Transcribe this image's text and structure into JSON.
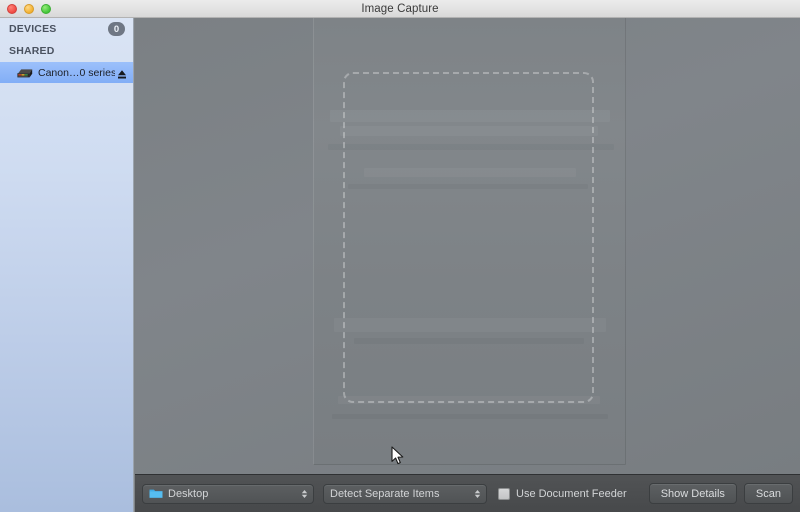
{
  "window": {
    "title": "Image Capture",
    "traffic_lights": [
      "close",
      "minimize",
      "zoom"
    ]
  },
  "sidebar": {
    "sections": [
      {
        "label": "DEVICES",
        "badge": "0",
        "items": []
      },
      {
        "label": "SHARED",
        "badge": "",
        "items": [
          {
            "label": "Canon…0 series",
            "icon": "scanner-icon",
            "eject": "eject-icon",
            "selected": true
          }
        ]
      }
    ]
  },
  "main": {
    "scan_preview": {
      "selection_label": "scan-selection-marquee"
    }
  },
  "bottombar": {
    "destination": {
      "icon": "folder-icon",
      "value": "Desktop"
    },
    "scan_mode": {
      "value": "Detect Separate Items"
    },
    "document_feeder": {
      "label": "Use Document Feeder",
      "checked": false
    },
    "show_details_label": "Show Details",
    "scan_label": "Scan"
  },
  "colors": {
    "titlebar": "#e4e4e4",
    "sidebar_top": "#dae4f4",
    "sidebar_bottom": "#aabede",
    "selection_blue": "#82aef6",
    "main_gray": "#7f8386",
    "bottombar": "#4a4c4e",
    "folder_blue": "#42a5e0"
  }
}
